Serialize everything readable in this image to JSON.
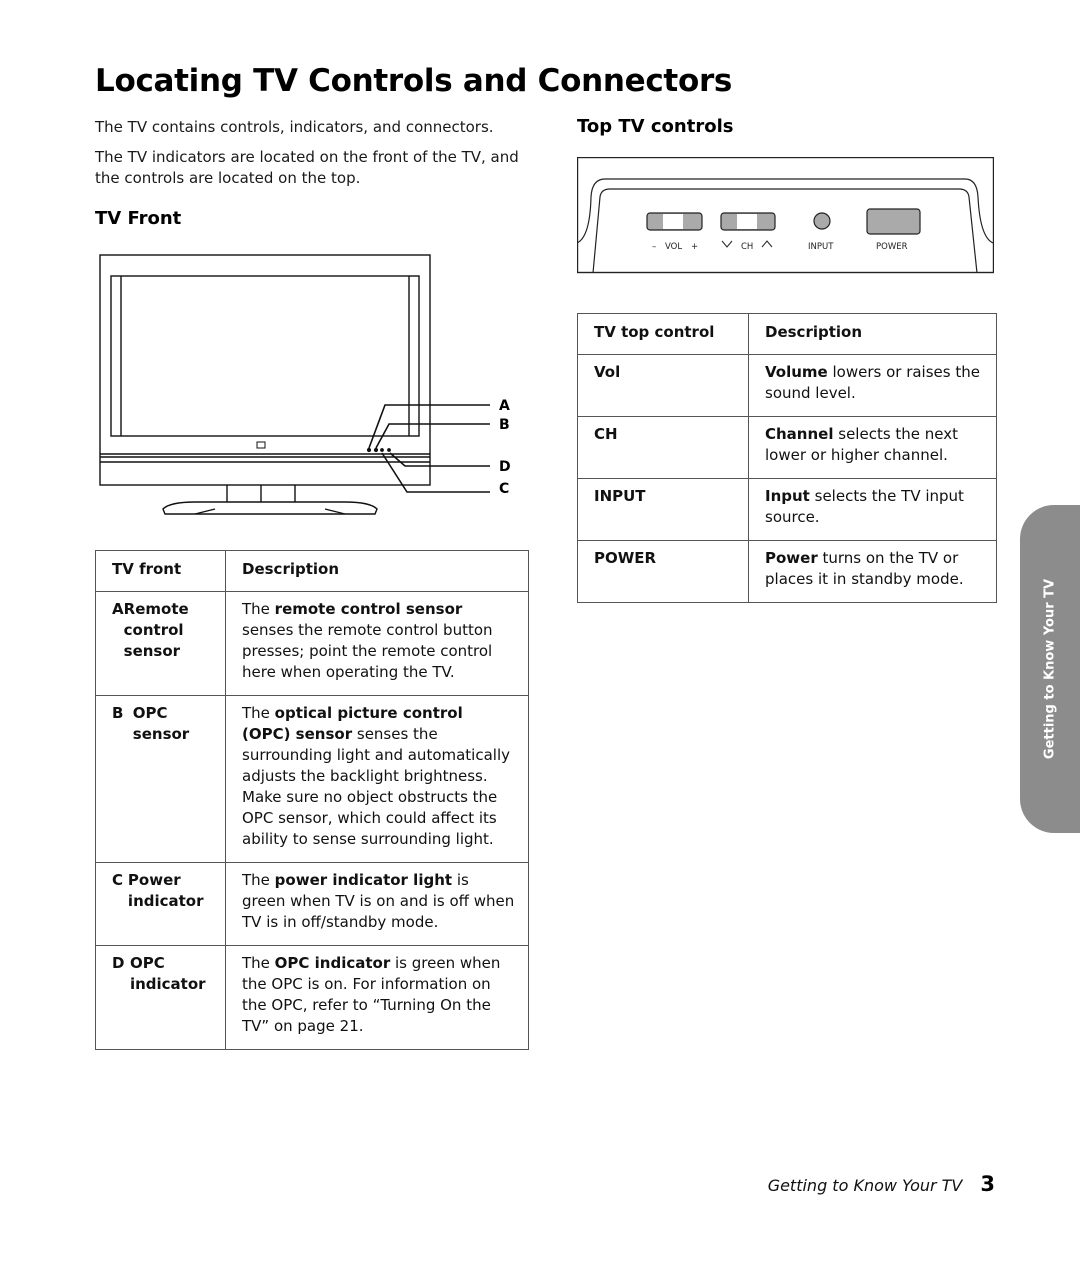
{
  "page": {
    "title": "Locating TV Controls and Connectors",
    "intro": [
      "The TV contains controls, indicators, and connectors.",
      "The TV indicators are located on the front of the TV, and the controls are located on the top."
    ]
  },
  "tv_front": {
    "heading": "TV Front",
    "callouts": [
      "A",
      "B",
      "D",
      "C"
    ],
    "table": {
      "headers": [
        "TV front",
        "Description"
      ],
      "rows": [
        {
          "letter": "A",
          "term": "Remote control sensor",
          "desc_pre": "The ",
          "desc_bold": "remote control sensor",
          "desc_post": " senses the remote control button presses; point the remote control here when operating the TV."
        },
        {
          "letter": "B",
          "term": "OPC sensor",
          "desc_pre": "The ",
          "desc_bold": "optical picture control (OPC) sensor",
          "desc_post": " senses the surrounding light and automatically adjusts the backlight brightness. Make sure no object obstructs the OPC sensor, which could affect its ability to sense surrounding light."
        },
        {
          "letter": "C",
          "term": "Power indicator",
          "desc_pre": "The ",
          "desc_bold": "power indicator light",
          "desc_post": " is green when TV is on and is off when TV is in off/standby mode."
        },
        {
          "letter": "D",
          "term": "OPC indicator",
          "desc_pre": "The ",
          "desc_bold": "OPC indicator",
          "desc_post": " is green when the OPC is on. For information on the OPC, refer to “Turning On the TV” on page 21."
        }
      ]
    }
  },
  "top_controls": {
    "heading": "Top TV controls",
    "labels": {
      "vol_minus": "–",
      "vol": "VOL",
      "vol_plus": "+",
      "ch": "CH",
      "input": "INPUT",
      "power": "POWER"
    },
    "table": {
      "headers": [
        "TV top control",
        "Description"
      ],
      "rows": [
        {
          "term": "Vol",
          "desc_bold": "Volume",
          "desc_post": " lowers or raises the sound level."
        },
        {
          "term": "CH",
          "desc_bold": "Channel",
          "desc_post": " selects the next lower or higher channel."
        },
        {
          "term": "INPUT",
          "desc_bold": "Input",
          "desc_post": " selects the TV input source."
        },
        {
          "term": "POWER",
          "desc_bold": "Power",
          "desc_post": " turns on the TV or places it in standby mode."
        }
      ]
    }
  },
  "side_tab": {
    "label": "Getting to Know Your TV",
    "color": "#8c8c8c"
  },
  "footer": {
    "section": "Getting to Know Your TV",
    "page_number": "3"
  }
}
